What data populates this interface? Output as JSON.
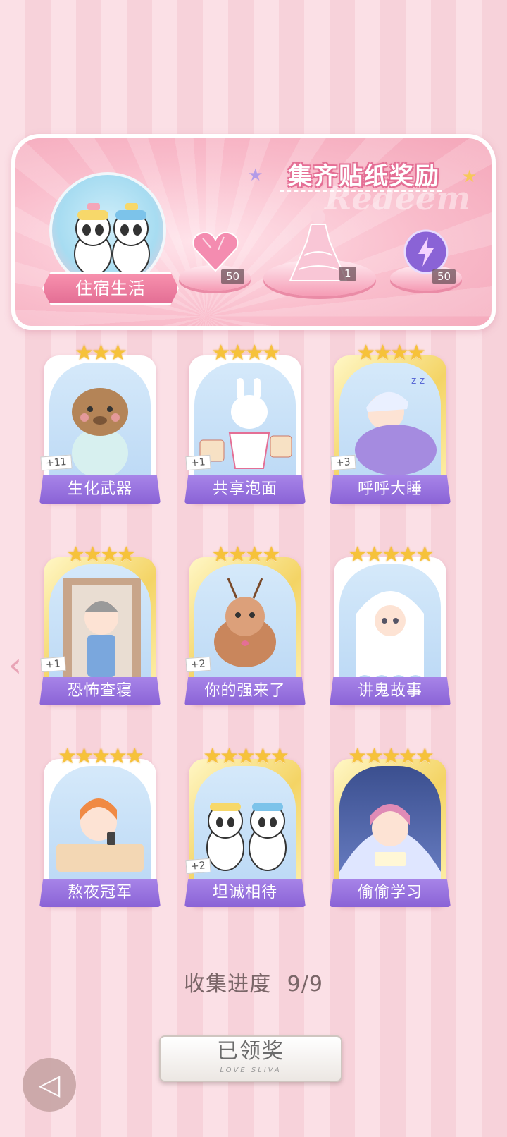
{
  "banner": {
    "title": "集齐贴纸奖励",
    "watermark": "Redeem",
    "theme_label": "住宿生活",
    "rewards": [
      {
        "icon": "pink-diamond-heart",
        "count": "50"
      },
      {
        "icon": "pink-gown-outfit",
        "count": "1"
      },
      {
        "icon": "purple-lightning-orb",
        "count": "50"
      }
    ]
  },
  "stickers": [
    {
      "name": "生化武器",
      "stars": "★★★",
      "dup": "+11",
      "icon": "capybara-pajamas"
    },
    {
      "name": "共享泡面",
      "stars": "★★★★",
      "dup": "+1",
      "icon": "bunny-instant-noodles"
    },
    {
      "name": "呼呼大睡",
      "stars": "★★★★",
      "dup": "+3",
      "icon": "boy-sleeping"
    },
    {
      "name": "恐怖查寝",
      "stars": "★★★★",
      "dup": "+1",
      "icon": "dorm-auntie"
    },
    {
      "name": "你的强来了",
      "stars": "★★★★",
      "dup": "+2",
      "icon": "cockroach"
    },
    {
      "name": "讲鬼故事",
      "stars": "★★★★★",
      "dup": "",
      "icon": "ghost-blanket"
    },
    {
      "name": "熬夜冠军",
      "stars": "★★★★★",
      "dup": "",
      "icon": "boy-phone-bed"
    },
    {
      "name": "坦诚相待",
      "stars": "★★★★★",
      "dup": "+2",
      "icon": "pandas-shower"
    },
    {
      "name": "偷偷学习",
      "stars": "★★★★★",
      "dup": "",
      "icon": "boy-reading-blanket"
    }
  ],
  "progress": {
    "label": "收集进度",
    "value": "9/9"
  },
  "claim_button": {
    "label": "已领奖",
    "sub": "LOVE SLIVA"
  },
  "colors": {
    "accent_pink": "#e46f95",
    "name_bar_purple": "#8a63d6",
    "star_gold": "#f6c23a"
  }
}
